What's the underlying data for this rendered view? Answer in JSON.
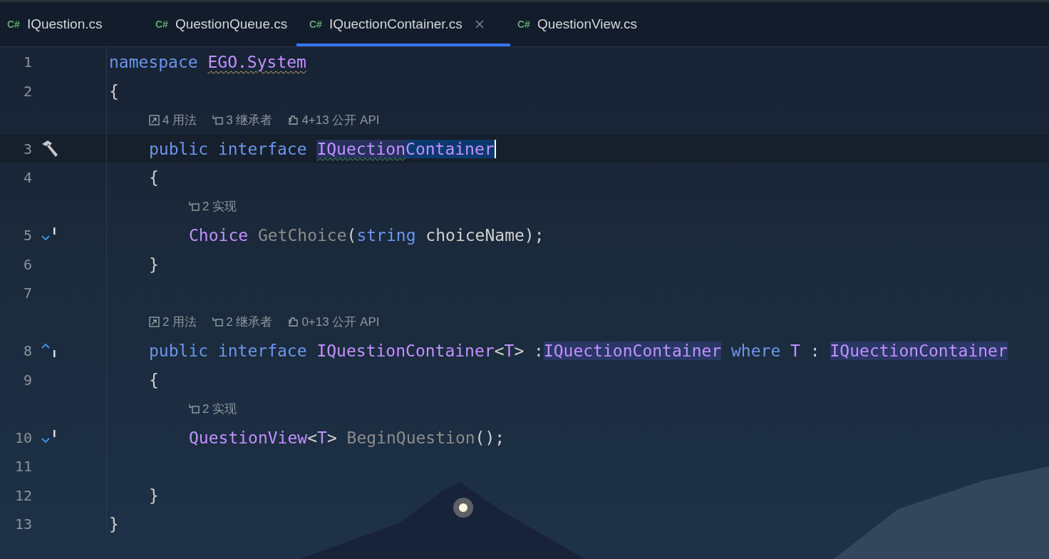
{
  "tabs": [
    {
      "label": "IQuestion.cs",
      "badge": "C#",
      "selected": false
    },
    {
      "label": "QuestionQueue.cs",
      "badge": "C#",
      "selected": false
    },
    {
      "label": "IQuectionContainer.cs",
      "badge": "C#",
      "selected": true
    },
    {
      "label": "QuestionView.cs",
      "badge": "C#",
      "selected": false
    }
  ],
  "editor": {
    "lines": [
      {
        "kind": "code",
        "number": "1",
        "current": false,
        "tokens": [
          {
            "text": "namespace ",
            "kind": "keyword"
          },
          {
            "text": "EGO.System",
            "kind": "type",
            "warning": true
          }
        ]
      },
      {
        "kind": "code",
        "number": "2",
        "current": false,
        "tokens": [
          {
            "text": "{",
            "kind": "plain"
          }
        ],
        "children": [
          {
            "kind": "hint",
            "hints": [
              {
                "kind": "usages",
                "text": "4 用法"
              },
              {
                "kind": "inheritors",
                "text": "3 继承者"
              },
              {
                "kind": "api",
                "text": "4+13 公开 API"
              }
            ]
          },
          {
            "kind": "code",
            "number": "3",
            "current": true,
            "gutter": {
              "kind": "hammer"
            },
            "caret": true,
            "tokens": [
              {
                "text": "public interface ",
                "kind": "keyword"
              },
              {
                "text": "IQuection",
                "kind": "type",
                "typo": true,
                "usage_highlight": true
              },
              {
                "text": "Container",
                "kind": "type",
                "selected": true
              }
            ]
          },
          {
            "kind": "code",
            "number": "4",
            "current": false,
            "tokens": [
              {
                "text": "{",
                "kind": "plain"
              }
            ],
            "children": [
              {
                "kind": "hint",
                "hints": [
                  {
                    "kind": "implementations",
                    "text": "2 实现"
                  }
                ]
              },
              {
                "kind": "code",
                "number": "5",
                "current": false,
                "gutter": {
                  "kind": "implemented"
                },
                "tokens": [
                  {
                    "text": "Choice ",
                    "kind": "type"
                  },
                  {
                    "text": "GetChoice",
                    "kind": "dim"
                  },
                  {
                    "text": "(",
                    "kind": "plain"
                  },
                  {
                    "text": "string ",
                    "kind": "keyword"
                  },
                  {
                    "text": "choiceName);",
                    "kind": "plain"
                  }
                ]
              }
            ]
          },
          {
            "kind": "code",
            "number": "6",
            "current": false,
            "tokens": [
              {
                "text": "}",
                "kind": "plain"
              }
            ]
          },
          {
            "kind": "code",
            "number": "7",
            "current": false
          },
          {
            "kind": "hint",
            "hints": [
              {
                "kind": "usages",
                "text": "2 用法"
              },
              {
                "kind": "inheritors",
                "text": "2 继承者"
              },
              {
                "kind": "api",
                "text": "0+13 公开 API"
              }
            ]
          },
          {
            "kind": "code",
            "number": "8",
            "current": false,
            "gutter": {
              "kind": "implementing"
            },
            "tokens": [
              {
                "text": "public interface ",
                "kind": "keyword"
              },
              {
                "text": "IQuestionContainer",
                "kind": "type"
              },
              {
                "text": "<",
                "kind": "plain"
              },
              {
                "text": "T",
                "kind": "type"
              },
              {
                "text": "> :",
                "kind": "plain"
              },
              {
                "text": "IQuectionContainer",
                "kind": "type",
                "usage_highlight": true
              },
              {
                "text": " where ",
                "kind": "keyword"
              },
              {
                "text": "T",
                "kind": "type"
              },
              {
                "text": " : ",
                "kind": "plain"
              },
              {
                "text": "IQuectionContainer",
                "kind": "type",
                "usage_highlight": true
              }
            ]
          },
          {
            "kind": "code",
            "number": "9",
            "current": false,
            "tokens": [
              {
                "text": "{",
                "kind": "plain"
              }
            ],
            "children": [
              {
                "kind": "hint",
                "hints": [
                  {
                    "kind": "implementations",
                    "text": "2 实现"
                  }
                ]
              },
              {
                "kind": "code",
                "number": "10",
                "current": false,
                "gutter": {
                  "kind": "implemented"
                },
                "tokens": [
                  {
                    "text": "QuestionView",
                    "kind": "type"
                  },
                  {
                    "text": "<",
                    "kind": "plain"
                  },
                  {
                    "text": "T",
                    "kind": "type"
                  },
                  {
                    "text": "> ",
                    "kind": "plain"
                  },
                  {
                    "text": "BeginQuestion",
                    "kind": "dim"
                  },
                  {
                    "text": "();",
                    "kind": "plain"
                  }
                ]
              },
              {
                "kind": "code",
                "number": "11",
                "current": false
              }
            ]
          },
          {
            "kind": "code",
            "number": "12",
            "current": false,
            "tokens": [
              {
                "text": "}",
                "kind": "plain"
              }
            ]
          }
        ]
      },
      {
        "kind": "code",
        "number": "13",
        "current": false,
        "tokens": [
          {
            "text": "}",
            "kind": "plain"
          }
        ]
      }
    ]
  }
}
